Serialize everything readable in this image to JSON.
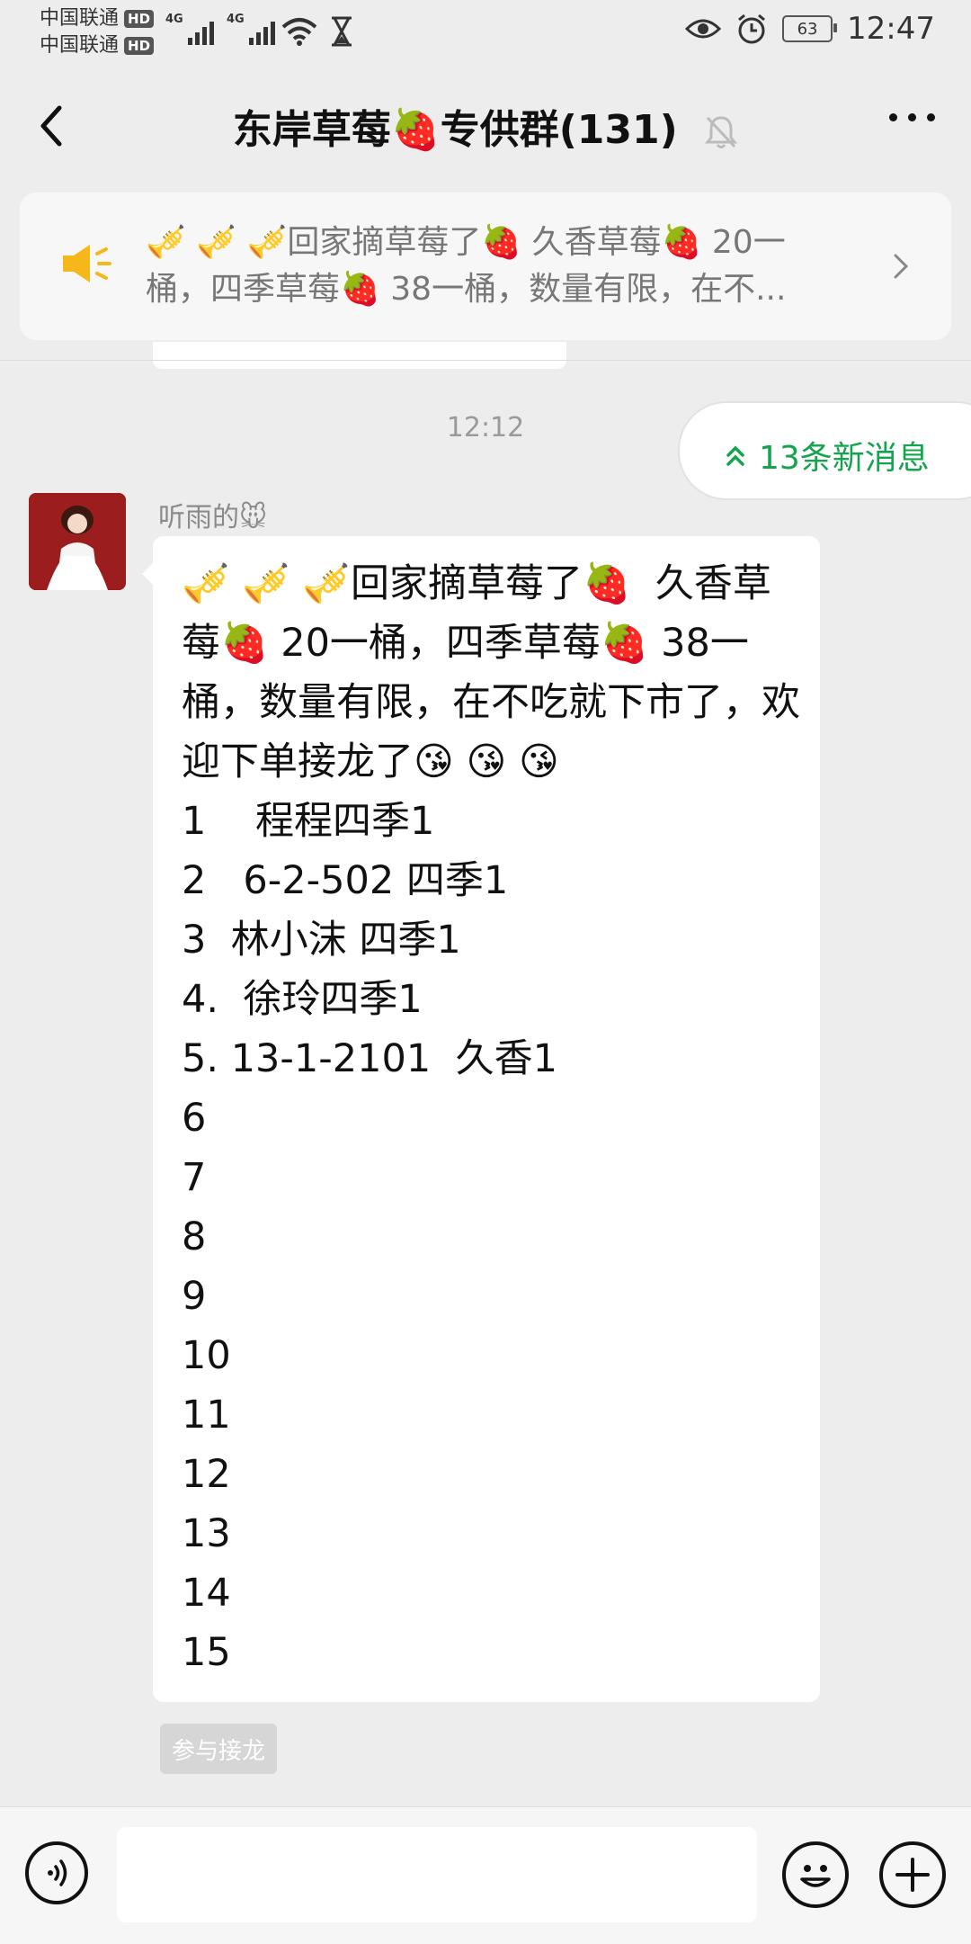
{
  "status_bar": {
    "carrier1": "中国联通",
    "carrier2": "中国联通",
    "hd": "HD",
    "network1": "4G",
    "network2": "4G",
    "battery": "63",
    "time": "12:47"
  },
  "header": {
    "title": "东岸草莓🍓专供群(131)"
  },
  "announcement": {
    "text": "🎺 🎺 🎺回家摘草莓了🍓  久香草莓🍓 20一桶，四季草莓🍓 38一桶，数量有限，在不..."
  },
  "chat": {
    "timestamp": "12:12",
    "new_messages": "13条新消息",
    "message": {
      "sender": "听雨的🐭",
      "text": "🎺 🎺 🎺回家摘草莓了🍓  久香草莓🍓 20一桶，四季草莓🍓 38一桶，数量有限，在不吃就下市了，欢迎下单接龙了😘 😘 😘\n1    程程四季1\n2   6-2-502 四季1\n3  林小沫 四季1\n4.  徐玲四季1\n5. 13-1-2101  久香1\n6\n7\n8\n9\n10\n11\n12\n13\n14\n15"
    },
    "join_button": "参与接龙"
  },
  "input": {
    "placeholder": ""
  }
}
